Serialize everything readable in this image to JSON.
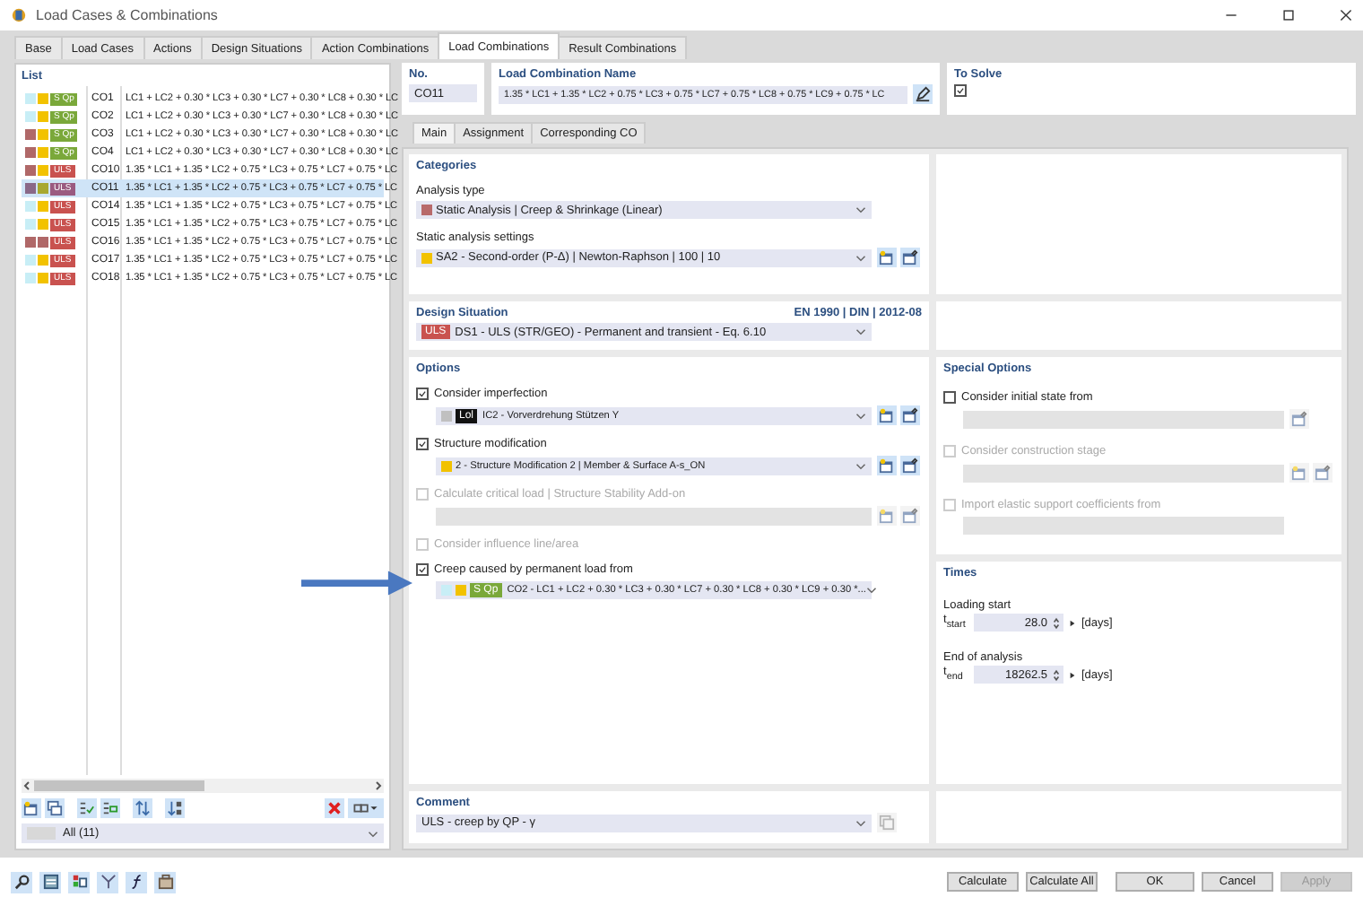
{
  "window": {
    "title": "Load Cases & Combinations"
  },
  "tabs": [
    {
      "label": "Base",
      "selected": false
    },
    {
      "label": "Load Cases",
      "selected": false
    },
    {
      "label": "Actions",
      "selected": false
    },
    {
      "label": "Design Situations",
      "selected": false
    },
    {
      "label": "Action Combinations",
      "selected": false
    },
    {
      "label": "Load Combinations",
      "selected": true
    },
    {
      "label": "Result Combinations",
      "selected": false
    }
  ],
  "list": {
    "title": "List",
    "items": [
      {
        "swatches": [
          {
            "color": "#c8eef6"
          },
          {
            "color": "#f2c200"
          }
        ],
        "tag": {
          "label": "S Qp",
          "color": "#7aa83a"
        },
        "no": "CO1",
        "name": "LC1 + LC2 + 0.30 * LC3 + 0.30 * LC7 + 0.30 * LC8 + 0.30 * LC",
        "selected": false
      },
      {
        "swatches": [
          {
            "color": "#c8eef6"
          },
          {
            "color": "#f2c200"
          }
        ],
        "tag": {
          "label": "S Qp",
          "color": "#7aa83a"
        },
        "no": "CO2",
        "name": "LC1 + LC2 + 0.30 * LC3 + 0.30 * LC7 + 0.30 * LC8 + 0.30 * LC",
        "selected": false
      },
      {
        "swatches": [
          {
            "color": "#b06868"
          },
          {
            "color": "#f2c200"
          }
        ],
        "tag": {
          "label": "S Qp",
          "color": "#7aa83a"
        },
        "no": "CO3",
        "name": "LC1 + LC2 + 0.30 * LC3 + 0.30 * LC7 + 0.30 * LC8 + 0.30 * LC",
        "selected": false
      },
      {
        "swatches": [
          {
            "color": "#b06868"
          },
          {
            "color": "#f2c200"
          }
        ],
        "tag": {
          "label": "S Qp",
          "color": "#7aa83a"
        },
        "no": "CO4",
        "name": "LC1 + LC2 + 0.30 * LC3 + 0.30 * LC7 + 0.30 * LC8 + 0.30 * LC",
        "selected": false
      },
      {
        "swatches": [
          {
            "color": "#b06868"
          },
          {
            "color": "#f2c200"
          }
        ],
        "tag": {
          "label": "ULS",
          "color": "#c9524f"
        },
        "no": "CO10",
        "name": "1.35 * LC1 + 1.35 * LC2 + 0.75 * LC3 + 0.75 * LC7 + 0.75 * LC",
        "selected": false
      },
      {
        "swatches": [
          {
            "color": "#8a6888"
          },
          {
            "color": "#a8a830"
          }
        ],
        "tag": {
          "label": "ULS",
          "color": "#9a5a80"
        },
        "no": "CO11",
        "name": "1.35 * LC1 + 1.35 * LC2 + 0.75 * LC3 + 0.75 * LC7 + 0.75 * LC",
        "selected": true
      },
      {
        "swatches": [
          {
            "color": "#c8eef6"
          },
          {
            "color": "#f2c200"
          }
        ],
        "tag": {
          "label": "ULS",
          "color": "#c9524f"
        },
        "no": "CO14",
        "name": "1.35 * LC1 + 1.35 * LC2 + 0.75 * LC3 + 0.75 * LC7 + 0.75 * LC",
        "selected": false
      },
      {
        "swatches": [
          {
            "color": "#c8eef6"
          },
          {
            "color": "#f2c200"
          }
        ],
        "tag": {
          "label": "ULS",
          "color": "#c9524f"
        },
        "no": "CO15",
        "name": "1.35 * LC1 + 1.35 * LC2 + 0.75 * LC3 + 0.75 * LC7 + 0.75 * LC",
        "selected": false
      },
      {
        "swatches": [
          {
            "color": "#b06868"
          },
          {
            "color": "#b06868"
          }
        ],
        "tag": {
          "label": "ULS",
          "color": "#c9524f"
        },
        "no": "CO16",
        "name": "1.35 * LC1 + 1.35 * LC2 + 0.75 * LC3 + 0.75 * LC7 + 0.75 * LC",
        "selected": false
      },
      {
        "swatches": [
          {
            "color": "#c8eef6"
          },
          {
            "color": "#f2c200"
          }
        ],
        "tag": {
          "label": "ULS",
          "color": "#c9524f"
        },
        "no": "CO17",
        "name": "1.35 * LC1 + 1.35 * LC2 + 0.75 * LC3 + 0.75 * LC7 + 0.75 * LC",
        "selected": false
      },
      {
        "swatches": [
          {
            "color": "#c8eef6"
          },
          {
            "color": "#f2c200"
          }
        ],
        "tag": {
          "label": "ULS",
          "color": "#c9524f"
        },
        "no": "CO18",
        "name": "1.35 * LC1 + 1.35 * LC2 + 0.75 * LC3 + 0.75 * LC7 + 0.75 * LC",
        "selected": false
      }
    ],
    "filter": "All (11)"
  },
  "header": {
    "no_label": "No.",
    "no": "CO11",
    "name_label": "Load Combination Name",
    "name": "1.35 * LC1 + 1.35 * LC2 + 0.75 * LC3 + 0.75 * LC7 + 0.75 * LC8 + 0.75 * LC9 + 0.75 * LC",
    "to_solve_label": "To Solve",
    "to_solve": true
  },
  "subtabs": [
    {
      "label": "Main",
      "selected": true
    },
    {
      "label": "Assignment",
      "selected": false
    },
    {
      "label": "Corresponding CO",
      "selected": false
    }
  ],
  "categories": {
    "title": "Categories",
    "analysis_type_label": "Analysis type",
    "analysis_type": {
      "color": "#b86a6a",
      "text": "Static Analysis | Creep & Shrinkage (Linear)"
    },
    "settings_label": "Static analysis settings",
    "settings": {
      "color": "#f2c200",
      "text": "SA2 - Second-order (P-Δ) | Newton-Raphson | 100 | 10"
    }
  },
  "design_situation": {
    "title": "Design Situation",
    "standard": "EN 1990 | DIN | 2012-08",
    "tag": {
      "label": "ULS",
      "color": "#c9524f"
    },
    "text": "DS1 - ULS (STR/GEO) - Permanent and transient - Eq. 6.10"
  },
  "options": {
    "title": "Options",
    "items": [
      {
        "label": "Consider imperfection",
        "checked": true,
        "disabled": false,
        "field": {
          "kind": "select",
          "tag": {
            "label": "Lol",
            "color": "#111111"
          },
          "swatches": [
            {
              "color": "#c0c0c0"
            }
          ],
          "text": "IC2 - Vorverdrehung Stützen Y"
        },
        "actions": [
          {
            "kind": "new"
          },
          {
            "kind": "edit"
          }
        ]
      },
      {
        "label": "Structure modification",
        "checked": true,
        "disabled": false,
        "field": {
          "kind": "select",
          "swatches": [
            {
              "color": "#f2c200"
            }
          ],
          "text": "2 - Structure Modification 2 | Member & Surface A-s_ON"
        },
        "actions": [
          {
            "kind": "new"
          },
          {
            "kind": "edit"
          }
        ]
      },
      {
        "label": "Calculate critical load | Structure Stability Add-on",
        "checked": false,
        "disabled": true,
        "field": {
          "kind": "blank"
        },
        "actions": [
          {
            "kind": "new"
          },
          {
            "kind": "edit"
          }
        ]
      },
      {
        "label": "Consider influence line/area",
        "checked": false,
        "disabled": true
      },
      {
        "label": "Creep caused by permanent load from",
        "checked": true,
        "disabled": false,
        "field": {
          "kind": "select",
          "swatches": [
            {
              "color": "#c8eef6"
            },
            {
              "color": "#f2c200"
            }
          ],
          "tag": {
            "label": "S Qp",
            "color": "#7aa83a"
          },
          "text": "CO2 - LC1 + LC2 + 0.30 * LC3 + 0.30 * LC7 + 0.30 * LC8 + 0.30 * LC9 + 0.30 *..."
        }
      }
    ]
  },
  "special_options": {
    "title": "Special Options",
    "items": [
      {
        "label": "Consider initial state from",
        "checked": false,
        "disabled": false,
        "field": {
          "kind": "blank"
        },
        "actions": [
          {
            "kind": "edit"
          }
        ]
      },
      {
        "label": "Consider construction stage",
        "checked": false,
        "disabled": true,
        "field": {
          "kind": "blank"
        },
        "actions": [
          {
            "kind": "new"
          },
          {
            "kind": "edit"
          }
        ]
      },
      {
        "label": "Import elastic support coefficients from",
        "checked": false,
        "disabled": true,
        "field": {
          "kind": "blank"
        }
      }
    ]
  },
  "times": {
    "title": "Times",
    "items": [
      {
        "label": "Loading start",
        "symbol": "t$_{start}$",
        "value": "28.0",
        "unit": "[days]"
      },
      {
        "label": "End of analysis",
        "symbol": "t$_{end}$",
        "value": "18262.5",
        "unit": "[days]"
      }
    ]
  },
  "comment": {
    "title": "Comment",
    "text": "ULS - creep by QP - γ"
  },
  "footer_buttons": [
    {
      "label": "Calculate",
      "disabled": false
    },
    {
      "label": "Calculate All",
      "disabled": false
    },
    {
      "label": "OK",
      "disabled": false
    },
    {
      "label": "Cancel",
      "disabled": false
    },
    {
      "label": "Apply",
      "disabled": true
    }
  ]
}
